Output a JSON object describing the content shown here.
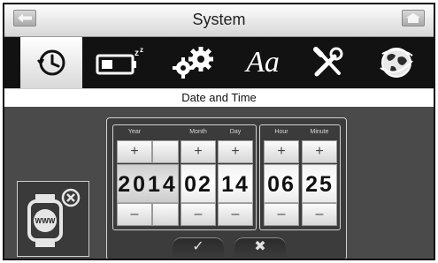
{
  "window": {
    "title": "System",
    "subtitle": "Date and Time"
  },
  "icons": {
    "tabs": [
      "clock-icon",
      "battery-sleep-icon",
      "gears-icon",
      "font-icon",
      "tools-icon",
      "globe-icon"
    ],
    "left_corner": "back-arrow-icon",
    "right_corner": "home-icon",
    "sync": "watch-internet-sync-icon"
  },
  "fonts_tab": {
    "label": "Aa"
  },
  "picker": {
    "date_columns": [
      {
        "label": "Year",
        "value": "2014"
      },
      {
        "label": "Month",
        "value": "02"
      },
      {
        "label": "Day",
        "value": "14"
      }
    ],
    "time_columns": [
      {
        "label": "Hour",
        "value": "06"
      },
      {
        "label": "Minute",
        "value": "25"
      }
    ],
    "plus_symbol": "+",
    "minus_symbol": "–"
  },
  "actions": {
    "confirm": "✓",
    "cancel": "✖"
  },
  "colors": {
    "titlebar": "#e6e6e6",
    "iconbar": "#121212",
    "background": "#4a4a4a",
    "picker_border": "#d2d2d2"
  }
}
